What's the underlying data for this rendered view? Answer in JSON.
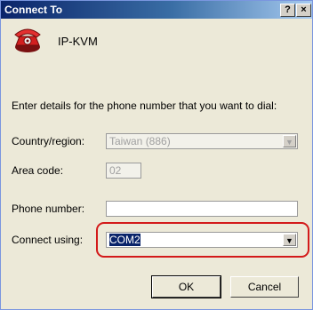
{
  "window": {
    "title": "Connect To",
    "help_label": "?",
    "close_label": "×"
  },
  "header": {
    "icon": "phone-icon",
    "name": "IP-KVM"
  },
  "prompt": "Enter details for the phone number that you want to dial:",
  "fields": {
    "country_label": "Country/region:",
    "country_value": "Taiwan (886)",
    "area_label": "Area code:",
    "area_value": "02",
    "phone_label": "Phone number:",
    "phone_value": "",
    "connect_label": "Connect using:",
    "connect_value": "COM2"
  },
  "buttons": {
    "ok": "OK",
    "cancel": "Cancel"
  },
  "colors": {
    "highlight": "#d31a1a",
    "selection": "#0a246a"
  }
}
